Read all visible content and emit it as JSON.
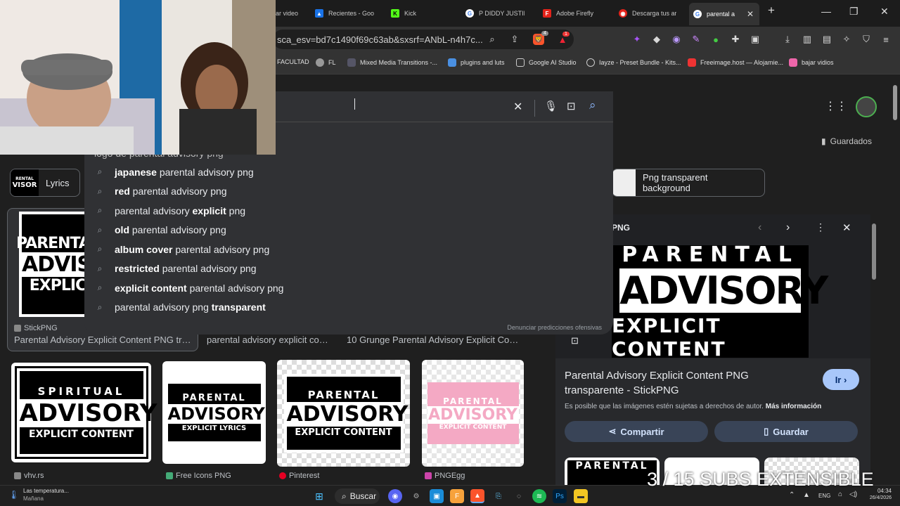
{
  "tabs": {
    "items": [
      {
        "label": "ar video",
        "color": "#555"
      },
      {
        "label": "Recientes - Goo",
        "color": "#1a73e8"
      },
      {
        "label": "Kick",
        "color": "#53fc18"
      },
      {
        "label": "P DIDDY JUSTIN",
        "color": "#fff"
      },
      {
        "label": "Adobe Firefly",
        "color": "#e4231a"
      },
      {
        "label": "Descarga tus ar",
        "color": "#e4231a"
      },
      {
        "label": "parental a",
        "color": "#fff"
      }
    ],
    "close_glyph": "✕",
    "new_tab_glyph": "+"
  },
  "window": {
    "minimize": "—",
    "restore": "❐",
    "close": "✕"
  },
  "address": {
    "url": "sca_esv=bd7c1490f69c63ab&sxsrf=ANbL-n4h7c..."
  },
  "extensions": {
    "brave_badge": "4",
    "alert_badge": "1"
  },
  "bookmarks": [
    "FACULTAD",
    "FL",
    "Mixed Media Transitions -...",
    "plugins and luts",
    "Google AI Studio",
    "Iayze - Preset Bundle - Kits...",
    "Freeimage.host — Alojamie...",
    "bajar vidios"
  ],
  "search": {
    "cut_suggestion": "logo de parental advisory png",
    "suggestions": [
      {
        "bold": "japanese",
        "rest": " parental advisory png",
        "bold_first": true
      },
      {
        "bold": "red",
        "rest": " parental advisory png",
        "bold_first": true
      },
      {
        "bold": "explicit",
        "pre": "parental advisory ",
        "rest": " png",
        "bold_first": false
      },
      {
        "bold": "old",
        "rest": " parental advisory png",
        "bold_first": true
      },
      {
        "bold": "album cover",
        "rest": " parental advisory png",
        "bold_first": true
      },
      {
        "bold": "restricted",
        "rest": " parental advisory png",
        "bold_first": true
      },
      {
        "bold": "explicit content",
        "rest": " parental advisory png",
        "bold_first": true
      },
      {
        "bold": "transparent",
        "pre": "parental advisory png ",
        "rest": "",
        "bold_first": false
      }
    ],
    "report_text": "Denunciar predicciones ofensivas"
  },
  "header": {
    "saved_label": "Guardados"
  },
  "chips": {
    "left": "Lyrics",
    "right": "Png transparent background"
  },
  "results_row1": {
    "source1": "StickPNG",
    "caption1": "Parental Advisory Explicit Content PNG tran...",
    "caption2": "parental advisory explicit cont...",
    "caption3": "10 Grunge Parental Advisory Explicit Conte..."
  },
  "thumb_text": {
    "parental": "PARENTAL",
    "advisory": "ADVISORY",
    "explicit": "EXPLIC",
    "explicit_content": "EXPLICIT CONTENT",
    "explicit_lyrics": "EXPLICIT LYRICS",
    "spiritual": "SPIRITUAL",
    "rental": "RENTAL",
    "visor": "VISOR"
  },
  "results_row2": [
    {
      "source": "vhv.rs"
    },
    {
      "source": "Free Icons PNG"
    },
    {
      "source": "Pinterest"
    },
    {
      "source": "PNGEgg"
    }
  ],
  "preview": {
    "header_tail": "PNG",
    "title": "Parental Advisory Explicit Content PNG transparente - StickPNG",
    "go_label": "Ir",
    "copyright": "Es posible que las imágenes estén sujetas a derechos de autor.",
    "more_info": "Más información",
    "share_label": "Compartir",
    "save_label": "Guardar"
  },
  "overlay": {
    "subs": "3 / 15 SUBS EXTENSIBLE"
  },
  "taskbar": {
    "weather_title": "Las temperatura...",
    "weather_sub": "Mañana",
    "search_label": "Buscar",
    "lang": "ENG",
    "time": "04:34",
    "date": "26/4/2026"
  },
  "colors": {
    "accent": "#8ab4f8",
    "preview_btn": "#394457",
    "go_btn": "#a8c7fa"
  }
}
